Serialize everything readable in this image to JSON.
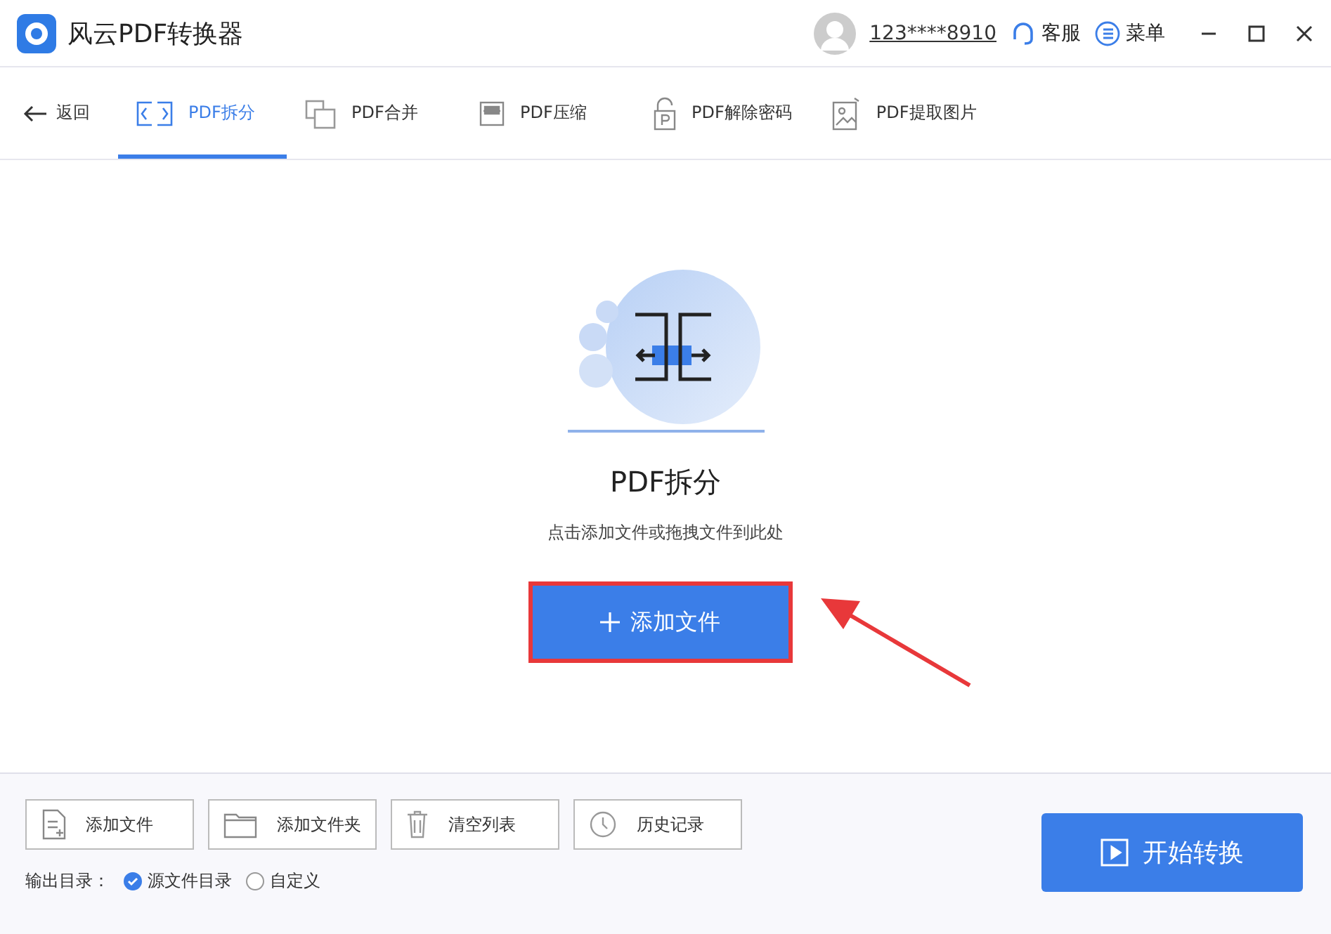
{
  "window": {
    "title": "风云PDF转换器"
  },
  "account": {
    "phone": "123****8910",
    "service": "客服",
    "menu": "菜单"
  },
  "nav": {
    "back": "返回",
    "tabs": [
      {
        "label": "PDF拆分",
        "kind": "split",
        "selected": true
      },
      {
        "label": "PDF合并",
        "kind": "merge",
        "selected": false
      },
      {
        "label": "PDF压缩",
        "kind": "zip",
        "selected": false
      },
      {
        "label": "PDF解除密码",
        "kind": "lock",
        "selected": false
      },
      {
        "label": "PDF提取图片",
        "kind": "image",
        "selected": false
      }
    ]
  },
  "drop_zone": {
    "title": "PDF拆分",
    "hint": "点击添加文件或拖拽文件到此处",
    "button": "添加文件",
    "highlighted": true
  },
  "toolbar": {
    "buttons": [
      {
        "label": "添加文件",
        "kind": "file"
      },
      {
        "label": "添加文件夹",
        "kind": "folder"
      },
      {
        "label": "清空列表",
        "kind": "trash"
      },
      {
        "label": "历史记录",
        "kind": "clock"
      }
    ],
    "start": "开始转换"
  },
  "output": {
    "label": "输出目录：",
    "options": [
      {
        "label": "源文件目录",
        "selected": true
      },
      {
        "label": "自定义",
        "selected": false
      }
    ]
  }
}
